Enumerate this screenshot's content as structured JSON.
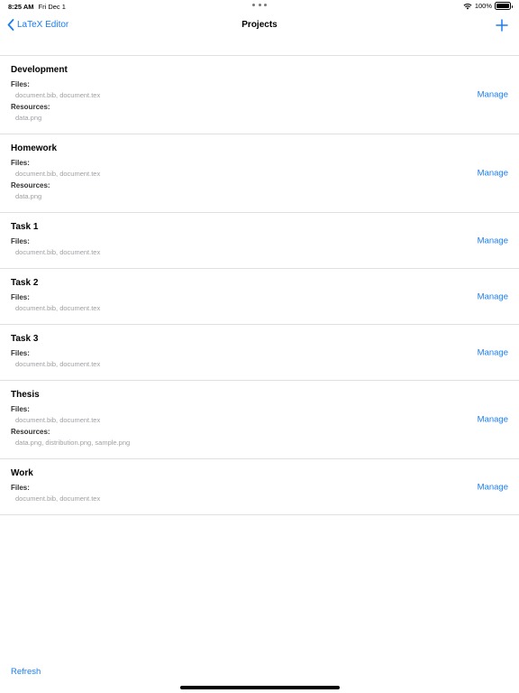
{
  "status_bar": {
    "time": "8:25 AM",
    "date": "Fri Dec 1",
    "battery": "100%"
  },
  "nav": {
    "back_label": "LaTeX Editor",
    "title": "Projects"
  },
  "projects": [
    {
      "name": "Development",
      "files_label": "Files:",
      "files": "document.bib, document.tex",
      "resources_label": "Resources:",
      "resources": "data.png",
      "action": "Manage"
    },
    {
      "name": "Homework",
      "files_label": "Files:",
      "files": "document.bib, document.tex",
      "resources_label": "Resources:",
      "resources": "data.png",
      "action": "Manage"
    },
    {
      "name": "Task 1",
      "files_label": "Files:",
      "files": "document.bib, document.tex",
      "action": "Manage"
    },
    {
      "name": "Task 2",
      "files_label": "Files:",
      "files": "document.bib, document.tex",
      "action": "Manage"
    },
    {
      "name": "Task 3",
      "files_label": "Files:",
      "files": "document.bib, document.tex",
      "action": "Manage"
    },
    {
      "name": "Thesis",
      "files_label": "Files:",
      "files": "document.bib, document.tex",
      "resources_label": "Resources:",
      "resources": "data.png, distribution.png, sample.png",
      "action": "Manage"
    },
    {
      "name": "Work",
      "files_label": "Files:",
      "files": "document.bib, document.tex",
      "action": "Manage"
    }
  ],
  "footer": {
    "refresh_label": "Refresh"
  },
  "colors": {
    "accent": "#1a7df0",
    "secondary_text": "#a0a0a5",
    "separator": "#e0e0e4"
  },
  "icons": {
    "back": "chevron-left-icon",
    "add": "plus-icon",
    "wifi": "wifi-icon",
    "battery": "battery-icon"
  }
}
